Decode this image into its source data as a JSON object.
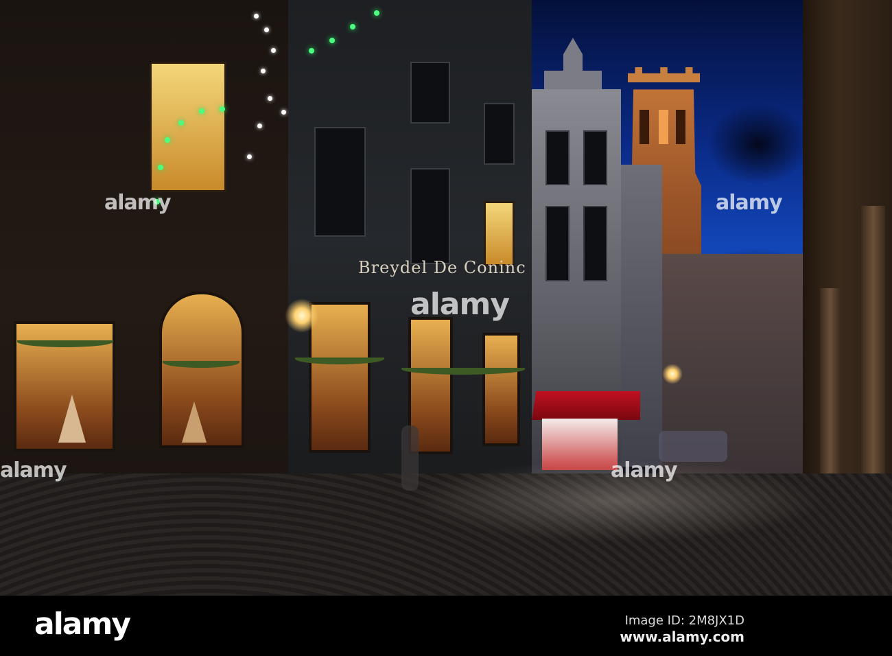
{
  "photo": {
    "subject": "",
    "shop_sign": "Breydel De Coninc",
    "watermark": "alamy"
  },
  "footer": {
    "logo": "alamy",
    "image_id": "Image ID: 2M8JX1D",
    "url": "www.alamy.com"
  }
}
